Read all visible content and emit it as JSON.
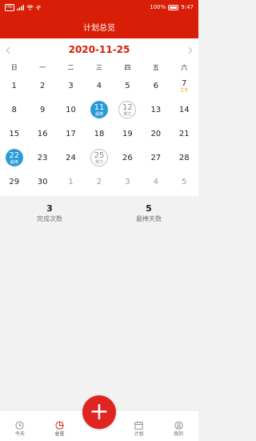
{
  "status_bar": {
    "battery": "100%",
    "time": "9:47",
    "sim_label": "HD"
  },
  "header": {
    "title": "计划总览"
  },
  "calendar": {
    "month_title": "2020-11-25",
    "weekdays": [
      "日",
      "一",
      "二",
      "三",
      "四",
      "五",
      "六"
    ],
    "days": [
      {
        "num": "1",
        "sub": "",
        "style": "plain"
      },
      {
        "num": "2",
        "sub": "",
        "style": "plain"
      },
      {
        "num": "3",
        "sub": "",
        "style": "plain"
      },
      {
        "num": "4",
        "sub": "",
        "style": "plain"
      },
      {
        "num": "5",
        "sub": "",
        "style": "plain"
      },
      {
        "num": "6",
        "sub": "",
        "style": "plain"
      },
      {
        "num": "7",
        "sub": "立冬",
        "style": "plain"
      },
      {
        "num": "8",
        "sub": "",
        "style": "plain"
      },
      {
        "num": "9",
        "sub": "",
        "style": "plain"
      },
      {
        "num": "10",
        "sub": "",
        "style": "plain"
      },
      {
        "num": "11",
        "sub": "最棒",
        "style": "filled"
      },
      {
        "num": "12",
        "sub": "努力",
        "style": "outline"
      },
      {
        "num": "13",
        "sub": "",
        "style": "plain"
      },
      {
        "num": "14",
        "sub": "",
        "style": "plain"
      },
      {
        "num": "15",
        "sub": "",
        "style": "plain"
      },
      {
        "num": "16",
        "sub": "",
        "style": "plain"
      },
      {
        "num": "17",
        "sub": "",
        "style": "plain"
      },
      {
        "num": "18",
        "sub": "",
        "style": "plain"
      },
      {
        "num": "19",
        "sub": "",
        "style": "plain"
      },
      {
        "num": "20",
        "sub": "",
        "style": "plain"
      },
      {
        "num": "21",
        "sub": "",
        "style": "plain"
      },
      {
        "num": "22",
        "sub": "最棒",
        "style": "filled"
      },
      {
        "num": "23",
        "sub": "",
        "style": "plain"
      },
      {
        "num": "24",
        "sub": "",
        "style": "plain"
      },
      {
        "num": "25",
        "sub": "努力",
        "style": "outline"
      },
      {
        "num": "26",
        "sub": "",
        "style": "plain"
      },
      {
        "num": "27",
        "sub": "",
        "style": "plain"
      },
      {
        "num": "28",
        "sub": "",
        "style": "plain"
      },
      {
        "num": "29",
        "sub": "",
        "style": "plain"
      },
      {
        "num": "30",
        "sub": "",
        "style": "plain"
      },
      {
        "num": "1",
        "sub": "",
        "style": "muted"
      },
      {
        "num": "2",
        "sub": "",
        "style": "muted"
      },
      {
        "num": "3",
        "sub": "",
        "style": "muted"
      },
      {
        "num": "4",
        "sub": "",
        "style": "muted"
      },
      {
        "num": "5",
        "sub": "",
        "style": "muted"
      }
    ]
  },
  "stats": {
    "completed_count": "3",
    "completed_label": "完成次数",
    "best_days": "5",
    "best_days_label": "最棒天数"
  },
  "tabbar": {
    "tabs": [
      {
        "label": "今天",
        "icon": "clock-icon"
      },
      {
        "label": "总览",
        "icon": "pie-chart-icon"
      },
      {
        "label": "计划",
        "icon": "calendar-icon"
      },
      {
        "label": "我的",
        "icon": "user-icon"
      }
    ],
    "fab_symbol": "+"
  },
  "colors": {
    "brand_red": "#d81e06",
    "accent_blue": "#2a9bd8"
  }
}
